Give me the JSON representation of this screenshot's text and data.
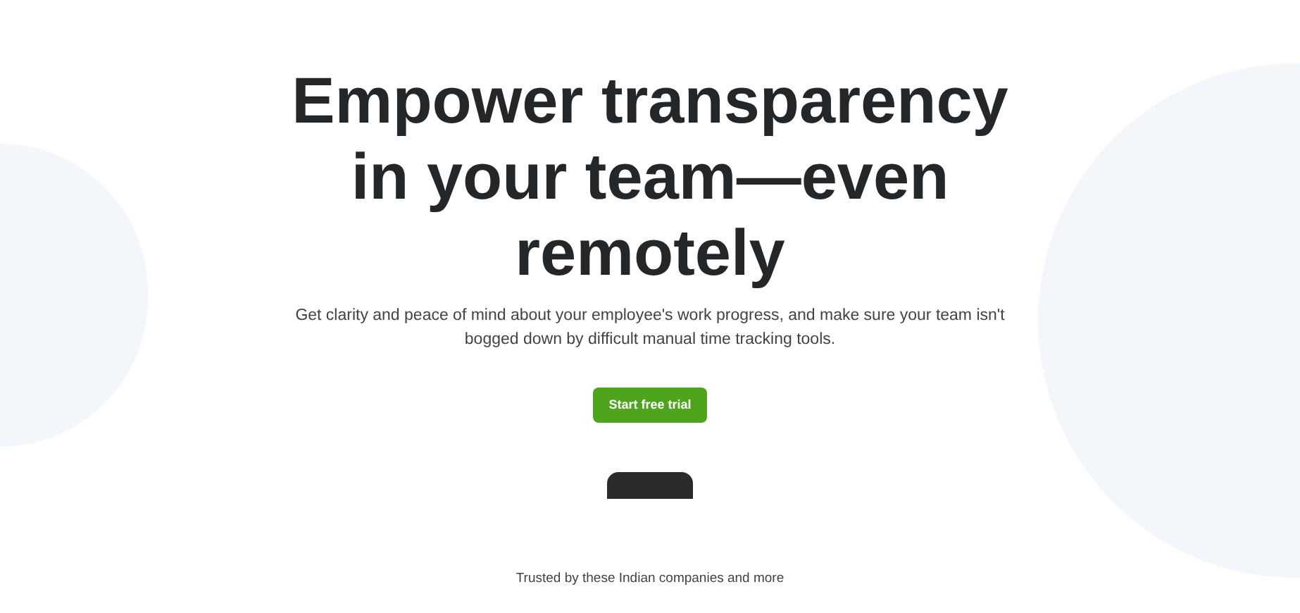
{
  "hero": {
    "title": "Empower transparency in your team—even remotely",
    "description": "Get clarity and peace of mind about your employee's work progress, and make sure your team isn't bogged down by difficult manual time tracking tools.",
    "cta_button": "Start free trial"
  },
  "trusted_caption": "Trusted by these Indian companies and more"
}
